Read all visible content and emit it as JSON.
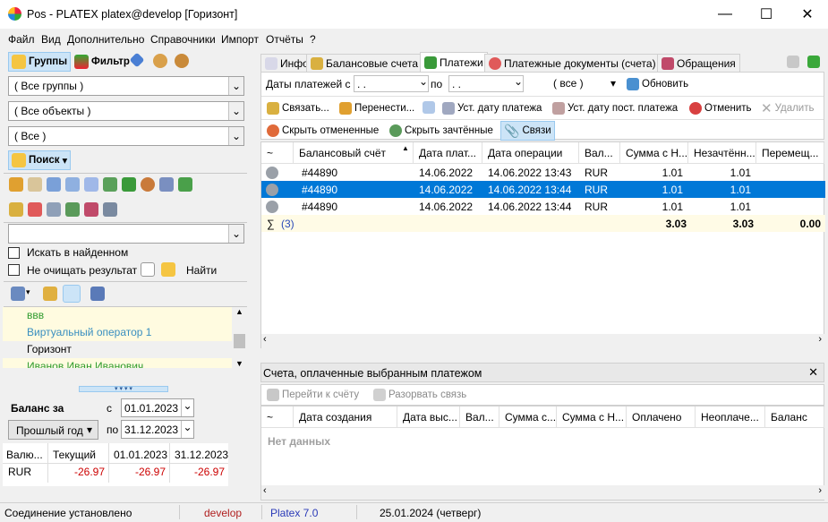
{
  "window": {
    "title": "Pos - PLATEX platex@develop [Горизонт]"
  },
  "menu": [
    {
      "label": "Файл"
    },
    {
      "label": "Вид"
    },
    {
      "label": "Дополнительно"
    },
    {
      "label": "Справочники"
    },
    {
      "label": "Импорт"
    },
    {
      "label": "Отчёты"
    },
    {
      "label": "?"
    }
  ],
  "left": {
    "groups_button": "Группы",
    "filter_button": "Фильтр",
    "combo_groups": "( Все группы )",
    "combo_objects": "( Все объекты )",
    "combo_all": "( Все )",
    "search_button": "Поиск",
    "search_in_found": "Искать в найденном",
    "dont_clear": "Не очищать результат",
    "find_label": "Найти",
    "list_items": [
      {
        "label": "ввв",
        "color": "#2e9b2e"
      },
      {
        "label": "Виртуальный оператор 1",
        "color": "#3a8fc0"
      },
      {
        "label": "Горизонт",
        "color": "#000000"
      },
      {
        "label": "Иванов Иван Иванович",
        "color": "#2e9b2e"
      }
    ],
    "balance_label": "Баланс за",
    "from_label": "с",
    "date_from": "01.01.2023",
    "period_value": "Прошлый год",
    "to_label": "по",
    "date_to": "31.12.2023",
    "balance_table": {
      "headers": [
        "Валю...",
        "Текущий",
        "01.01.2023",
        "31.12.2023"
      ],
      "rows": [
        [
          "RUR",
          "-26.97",
          "-26.97",
          "-26.97"
        ]
      ]
    }
  },
  "tabs": [
    {
      "label": "Инфо"
    },
    {
      "label": "Балансовые счета"
    },
    {
      "label": "Платежи"
    },
    {
      "label": "Платежные документы (счета)"
    },
    {
      "label": "Обращения"
    }
  ],
  "filter": {
    "dates_label": "Даты платежей с",
    "date_from": " .  .",
    "to_label": "по",
    "date_to": " .  .",
    "all_value": "( все )",
    "refresh": "Обновить"
  },
  "toolbar1": {
    "link": "Связать...",
    "move": "Перенести...",
    "set_pay_date": "Уст. дату платежа",
    "set_post_date": "Уст. дату пост. платежа",
    "cancel": "Отменить",
    "delete": "Удалить"
  },
  "toolbar2": {
    "hide_cancelled": "Скрыть отмененные",
    "hide_credited": "Скрыть зачтённые",
    "links": "Связи"
  },
  "payments_grid": {
    "headers": [
      "~",
      "Балансовый счёт",
      "Дата плат...",
      "Дата операции",
      "Вал...",
      "Сумма с Н...",
      "Незачтённ...",
      "Перемещ..."
    ],
    "rows": [
      [
        "",
        "#44890",
        "14.06.2022",
        "14.06.2022 13:43",
        "RUR",
        "1.01",
        "1.01",
        ""
      ],
      [
        "",
        "#44890",
        "14.06.2022",
        "14.06.2022 13:44",
        "RUR",
        "1.01",
        "1.01",
        ""
      ],
      [
        "",
        "#44890",
        "14.06.2022",
        "14.06.2022 13:44",
        "RUR",
        "1.01",
        "1.01",
        ""
      ]
    ],
    "selected_index": 1,
    "total": {
      "sigma": "∑",
      "count": "(3)",
      "sum": "3.03",
      "uncredited": "3.03",
      "moved": "0.00"
    }
  },
  "bottom_panel": {
    "title": "Счета, оплаченные выбранным платежом",
    "goto": "Перейти к счёту",
    "break_link": "Разорвать связь",
    "headers": [
      "~",
      "Дата создания",
      "Дата выс...",
      "Вал...",
      "Сумма с...",
      "Сумма с Н...",
      "Оплачено",
      "Неоплаче...",
      "Баланс"
    ],
    "empty": "Нет данных"
  },
  "status": {
    "connection": "Соединение установлено",
    "db": "develop",
    "version": "Platex 7.0",
    "date": "25.01.2024 (четверг)"
  },
  "colors": {
    "selection": "#0078d7",
    "negative": "#cc0000",
    "total_bg": "#fffbe6"
  }
}
